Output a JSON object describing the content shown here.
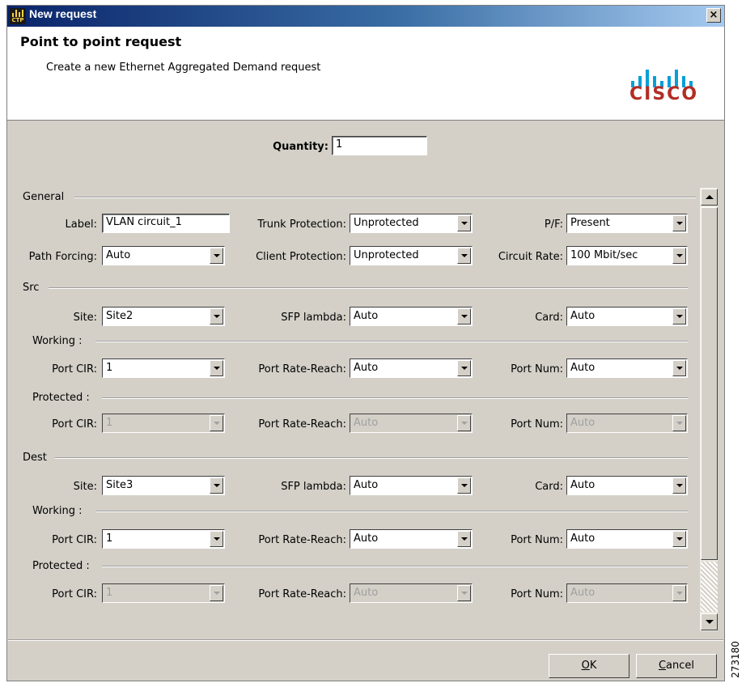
{
  "window": {
    "title": "New request",
    "close_glyph": "×",
    "app_icon_text": "CTP"
  },
  "banner": {
    "title": "Point to point request",
    "subtitle": "Create a new Ethernet Aggregated Demand request",
    "logo_word": "CISCO"
  },
  "quantity": {
    "label": "Quantity:",
    "value": "1"
  },
  "general": {
    "header": "General",
    "label_field": {
      "label": "Label:",
      "value": "VLAN circuit_1"
    },
    "trunk_protection": {
      "label": "Trunk Protection:",
      "value": "Unprotected"
    },
    "pf": {
      "label": "P/F:",
      "value": "Present"
    },
    "path_forcing": {
      "label": "Path Forcing:",
      "value": "Auto"
    },
    "client_protection": {
      "label": "Client Protection:",
      "value": "Unprotected"
    },
    "circuit_rate": {
      "label": "Circuit Rate:",
      "value": "100 Mbit/sec"
    }
  },
  "src": {
    "header": "Src",
    "site": {
      "label": "Site:",
      "value": "Site2"
    },
    "sfp": {
      "label": "SFP lambda:",
      "value": "Auto"
    },
    "card": {
      "label": "Card:",
      "value": "Auto"
    },
    "working": {
      "header": "Working :",
      "port_cir": {
        "label": "Port CIR:",
        "value": "1"
      },
      "rate_reach": {
        "label": "Port Rate-Reach:",
        "value": "Auto"
      },
      "port_num": {
        "label": "Port Num:",
        "value": "Auto"
      }
    },
    "protected": {
      "header": "Protected :",
      "port_cir": {
        "label": "Port CIR:",
        "value": "1"
      },
      "rate_reach": {
        "label": "Port Rate-Reach:",
        "value": "Auto"
      },
      "port_num": {
        "label": "Port Num:",
        "value": "Auto"
      }
    }
  },
  "dest": {
    "header": "Dest",
    "site": {
      "label": "Site:",
      "value": "Site3"
    },
    "sfp": {
      "label": "SFP lambda:",
      "value": "Auto"
    },
    "card": {
      "label": "Card:",
      "value": "Auto"
    },
    "working": {
      "header": "Working :",
      "port_cir": {
        "label": "Port CIR:",
        "value": "1"
      },
      "rate_reach": {
        "label": "Port Rate-Reach:",
        "value": "Auto"
      },
      "port_num": {
        "label": "Port Num:",
        "value": "Auto"
      }
    },
    "protected": {
      "header": "Protected :",
      "port_cir": {
        "label": "Port CIR:",
        "value": "1"
      },
      "rate_reach": {
        "label": "Port Rate-Reach:",
        "value": "Auto"
      },
      "port_num": {
        "label": "Port Num:",
        "value": "Auto"
      }
    }
  },
  "buttons": {
    "ok_mnemonic": "O",
    "ok_rest": "K",
    "cancel_mnemonic": "C",
    "cancel_rest": "ancel"
  },
  "figure_number": "273180",
  "colors": {
    "title_bar": "#0a246a",
    "cisco_blue": "#049fd9",
    "cisco_red": "#b22d24",
    "dialog_bg": "#d4d0c8"
  }
}
